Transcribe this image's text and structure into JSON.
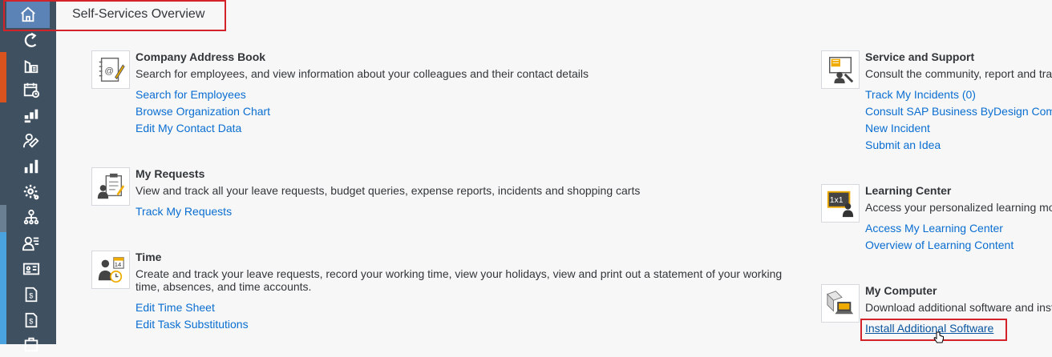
{
  "header": {
    "title": "Self-Services Overview"
  },
  "sidebar": {
    "items": [
      {
        "icon": "home-icon"
      },
      {
        "icon": "refresh-icon"
      },
      {
        "icon": "building-chart-icon"
      },
      {
        "icon": "calendar-icon"
      },
      {
        "icon": "analytics-icon"
      },
      {
        "icon": "person-edit-icon"
      },
      {
        "icon": "bar-chart-icon"
      },
      {
        "icon": "settings-icon"
      },
      {
        "icon": "org-chart-icon"
      },
      {
        "icon": "person-list-icon"
      },
      {
        "icon": "id-card-icon"
      },
      {
        "icon": "expense-document-icon"
      },
      {
        "icon": "person-expense-icon"
      },
      {
        "icon": "travel-icon"
      }
    ],
    "stripe_colors": [
      "#d9531e",
      "#6b7f92",
      "#4aa3df"
    ]
  },
  "cards": {
    "address_book": {
      "title": "Company Address Book",
      "description": "Search for employees, and view information about your colleagues and their contact details",
      "links": [
        "Search for Employees",
        "Browse Organization Chart",
        "Edit My Contact Data"
      ]
    },
    "requests": {
      "title": "My Requests",
      "description": "View and track all your leave requests, budget queries, expense reports, incidents and shopping carts",
      "links": [
        "Track My Requests"
      ]
    },
    "time": {
      "title": "Time",
      "description": "Create and track your leave requests, record your working time, view your holidays, view and print out a statement of your working time, absences, and time accounts.",
      "links": [
        "Edit Time Sheet",
        "Edit Task Substitutions"
      ],
      "icon_badge": "14"
    },
    "service": {
      "title": "Service and Support",
      "description": "Consult the community, report and tra",
      "links": [
        "Track My Incidents (0)",
        "Consult SAP Business ByDesign Comm",
        "New Incident",
        "Submit an Idea"
      ]
    },
    "learning": {
      "title": "Learning Center",
      "description": "Access your personalized learning mo",
      "links": [
        "Access My Learning Center",
        "Overview of Learning Content"
      ],
      "icon_badge": "1x1"
    },
    "computer": {
      "title": "My Computer",
      "description": "Download additional software and inst",
      "links": [
        "Install Additional Software"
      ]
    }
  },
  "colors": {
    "link": "#0a6ed1",
    "highlight": "#d3232a",
    "rail": "#3f5061",
    "home_active": "#5b83b6"
  }
}
